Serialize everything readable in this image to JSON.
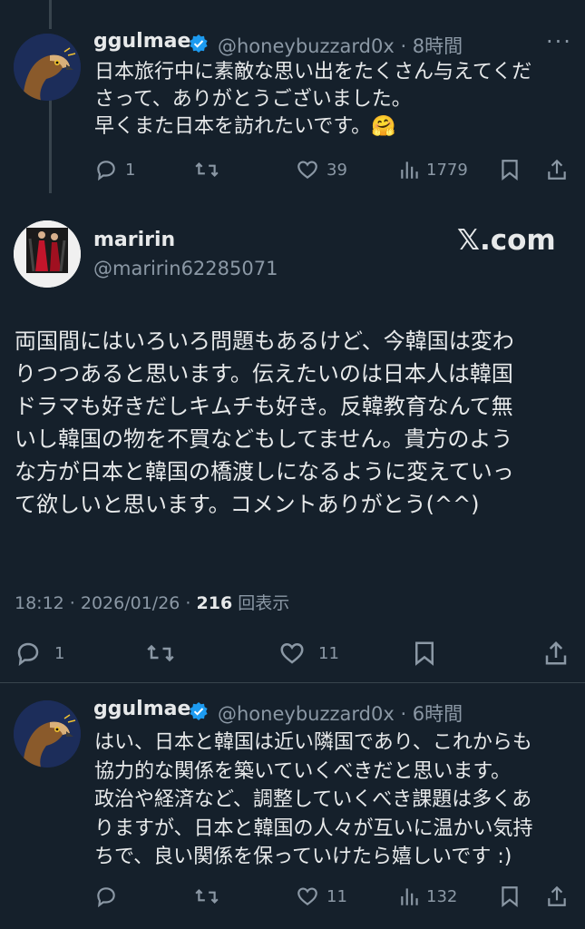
{
  "tweet1": {
    "name": "ggulmae",
    "handle": "@honeybuzzard0x",
    "time": "8時間",
    "lines": [
      "日本旅行中に素敵な思い出をたくさん与えてくだ",
      "さって、ありがとうございました。",
      "早くまた日本を訪れたいです。🤗"
    ],
    "replies": "1",
    "retweets": "",
    "likes": "39",
    "views": "1779"
  },
  "main": {
    "name": "maririn",
    "handle": "@maririn62285071",
    "brand": "𝕏.com",
    "lines": [
      "両国間にはいろいろ問題もあるけど、今韓国は変わ",
      "りつつあると思います。伝えたいのは日本人は韓国",
      "ドラマも好きだしキムチも好き。反韓教育なんて無",
      "いし韓国の物を不買などもしてません。貴方のよう",
      "な方が日本と韓国の橋渡しになるように変えていっ",
      "て欲しいと思います。コメントありがとう(^^)"
    ],
    "timestamp": "18:12 · 2026/01/26 · ",
    "views_count": "216",
    "views_label": " 回表示",
    "replies": "1",
    "likes": "11"
  },
  "tweet3": {
    "name": "ggulmae",
    "handle": "@honeybuzzard0x",
    "time": "6時間",
    "lines": [
      "はい、日本と韓国は近い隣国であり、これからも",
      "協力的な関係を築いていくべきだと思います。",
      "政治や経済など、調整していくべき課題は多くあ",
      "りますが、日本と韓国の人々が互いに温かい気持",
      "ちで、良い関係を保っていけたら嬉しいです :)"
    ],
    "likes": "11",
    "views": "132"
  },
  "colors": {
    "background": "#15202b",
    "text": "#e7e9ea",
    "muted": "#8b98a5",
    "verified": "#1d9bf0",
    "divider": "#38444d"
  },
  "icons": [
    "reply-icon",
    "retweet-icon",
    "like-icon",
    "views-icon",
    "bookmark-icon",
    "share-icon",
    "verified-icon",
    "more-icon"
  ]
}
